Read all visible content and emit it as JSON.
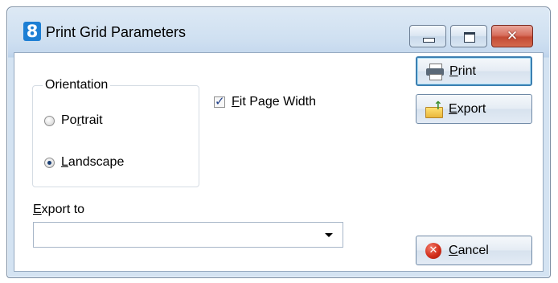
{
  "window": {
    "title": "Print Grid Parameters",
    "app_icon_glyph": "8"
  },
  "title_buttons": {
    "close_glyph": "✕"
  },
  "orientation": {
    "legend": "Orientation",
    "options": [
      {
        "label": "Portrait",
        "access_key_index": 2,
        "checked": false
      },
      {
        "label": "Landscape",
        "access_key_index": 0,
        "checked": true
      }
    ]
  },
  "fit_page_width": {
    "label": "Fit Page Width",
    "checked": true
  },
  "export_to": {
    "label": "Export to",
    "value": ""
  },
  "buttons": {
    "print": "Print",
    "export": "Export",
    "cancel": "Cancel",
    "cancel_glyph": "✕"
  },
  "icons": {
    "app": "app-logo-icon",
    "print": "printer-icon",
    "export": "folder-export-icon",
    "cancel": "cancel-icon"
  },
  "colors": {
    "accent": "#3c7fb1",
    "close_button": "#c34a34",
    "cancel_icon": "#d3301c"
  }
}
